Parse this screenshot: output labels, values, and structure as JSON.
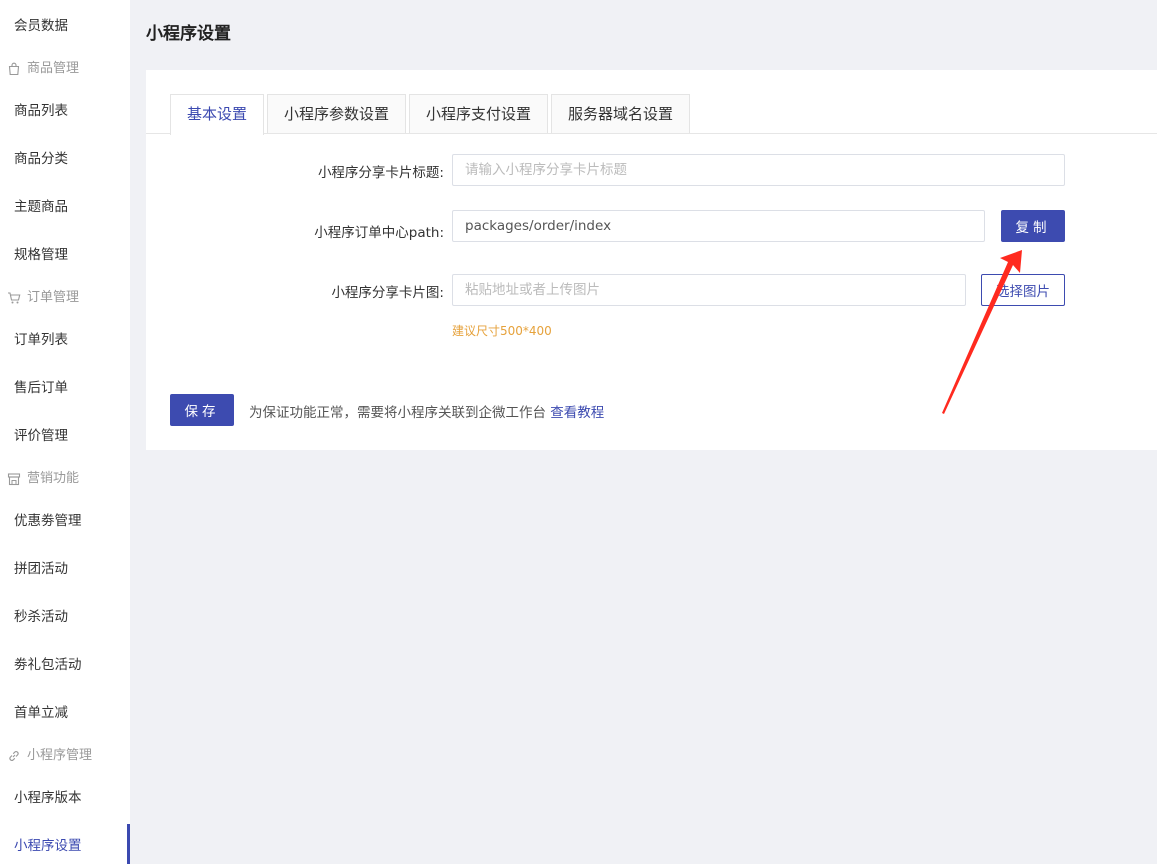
{
  "sidebar": {
    "items": [
      {
        "label": "会员数据"
      },
      {
        "group": "商品管理",
        "icon": "shopping-bag-icon"
      },
      {
        "label": "商品列表"
      },
      {
        "label": "商品分类"
      },
      {
        "label": "主题商品"
      },
      {
        "label": "规格管理"
      },
      {
        "group": "订单管理",
        "icon": "cart-icon"
      },
      {
        "label": "订单列表"
      },
      {
        "label": "售后订单"
      },
      {
        "label": "评价管理"
      },
      {
        "group": "营销功能",
        "icon": "store-icon"
      },
      {
        "label": "优惠劵管理"
      },
      {
        "label": "拼团活动"
      },
      {
        "label": "秒杀活动"
      },
      {
        "label": "劵礼包活动"
      },
      {
        "label": "首单立减"
      },
      {
        "group": "小程序管理",
        "icon": "link-icon"
      },
      {
        "label": "小程序版本"
      },
      {
        "label": "小程序设置",
        "active": true
      }
    ]
  },
  "page": {
    "title": "小程序设置"
  },
  "tabs": [
    "基本设置",
    "小程序参数设置",
    "小程序支付设置",
    "服务器域名设置"
  ],
  "form": {
    "share_title_label": "小程序分享卡片标题:",
    "share_title_placeholder": "请输入小程序分享卡片标题",
    "order_path_label": "小程序订单中心path:",
    "order_path_value": "packages/order/index",
    "copy_label": "复制",
    "share_image_label": "小程序分享卡片图:",
    "share_image_placeholder": "粘贴地址或者上传图片",
    "select_image_label": "选择图片",
    "size_hint": "建议尺寸500*400"
  },
  "footer": {
    "save_label": "保存",
    "note": "为保证功能正常，需要将小程序关联到企微工作台",
    "tutorial_link": "查看教程"
  },
  "colors": {
    "primary": "#3d4bb0",
    "hint": "#e6a23c",
    "annotation_arrow": "#ff2a1f"
  }
}
